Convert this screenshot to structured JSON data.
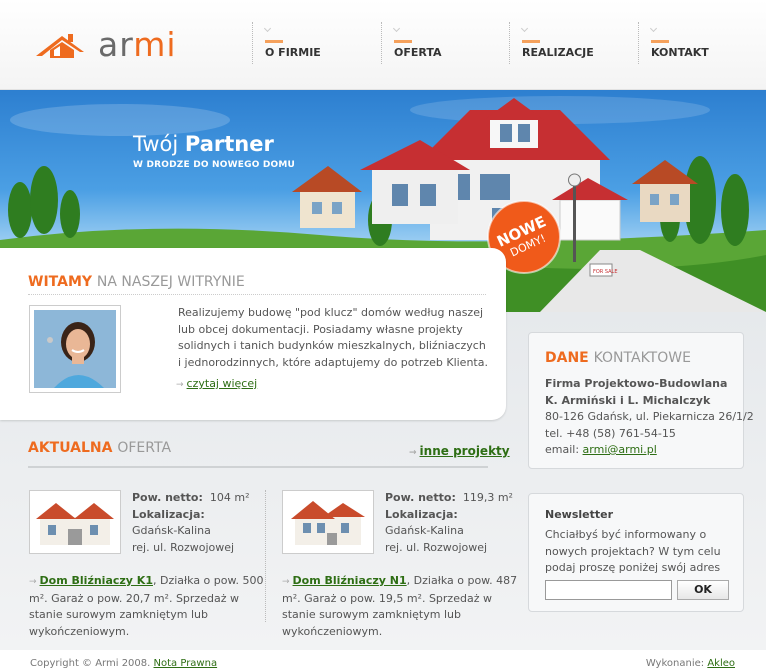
{
  "brand": {
    "logo_text_a": "ar",
    "logo_text_b": "mi"
  },
  "nav": [
    {
      "label": "O FIRMIE"
    },
    {
      "label": "OFERTA"
    },
    {
      "label": "REALIZACJE"
    },
    {
      "label": "KONTAKT"
    }
  ],
  "banner": {
    "title_a": "Twój ",
    "title_b": "Partner",
    "subtitle": "W DRODZE DO NOWEGO DOMU",
    "badge_line1": "NOWE",
    "badge_line2": "DOMY!",
    "sign": "FOR SALE"
  },
  "welcome": {
    "title_a": "WITAMY",
    "title_b": "NA NASZEJ WITRYNIE",
    "text": "Realizujemy budowę \"pod klucz\" domów według naszej lub obcej dokumentacji. Posiadamy własne projekty solidnych i tanich budynków mieszkalnych, bliźniaczych i jednorodzinnych, które adaptujemy do potrzeb Klienta.",
    "more": "czytaj więcej"
  },
  "offers": {
    "title_a": "AKTUALNA",
    "title_b": "OFERTA",
    "more": "inne projekty",
    "items": [
      {
        "area_label": "Pow. netto:",
        "area_value": "104 m²",
        "location_label": "Lokalizacja:",
        "location_1": "Gdańsk-Kalina",
        "location_2": "rej. ul. Rozwojowej",
        "link": "Dom Bliźniaczy K1",
        "desc": ", Działka o pow. 500 m². Garaż o pow. 20,7 m². Sprzedaż w stanie surowym zamkniętym lub wykończeniowym."
      },
      {
        "area_label": "Pow. netto:",
        "area_value": "119,3 m²",
        "location_label": "Lokalizacja:",
        "location_1": "Gdańsk-Kalina",
        "location_2": "rej. ul. Rozwojowej",
        "link": "Dom Bliźniaczy N1",
        "desc": ", Działka o pow. 487 m². Garaż o pow. 19,5 m². Sprzedaż w stanie surowym zamkniętym lub wykończeniowym."
      }
    ]
  },
  "contact": {
    "title_a": "DANE",
    "title_b": "KONTAKTOWE",
    "line1": "Firma Projektowo-Budowlana",
    "line2": "K. Armiński i L. Michalczyk",
    "address": "80-126 Gdańsk, ul. Piekarnicza 26/1/2",
    "phone": "tel. +48 (58) 761-54-15",
    "email_label": "email: ",
    "email": "armi@armi.pl"
  },
  "newsletter": {
    "title": "Newsletter",
    "text": "Chciałbyś być informowany o nowych projektach? W tym celu podaj proszę poniżej swój adres email.",
    "input_value": "",
    "button": "OK"
  },
  "footer": {
    "copyright": "Copyright © Armi 2008. ",
    "legal": "Nota Prawna",
    "made_by_label": "Wykonanie: ",
    "made_by": "Akleo"
  },
  "colors": {
    "accent": "#ee6b1f",
    "link": "#2e6e14",
    "sky": "#2d7fd0",
    "grass": "#4a9b2a"
  }
}
